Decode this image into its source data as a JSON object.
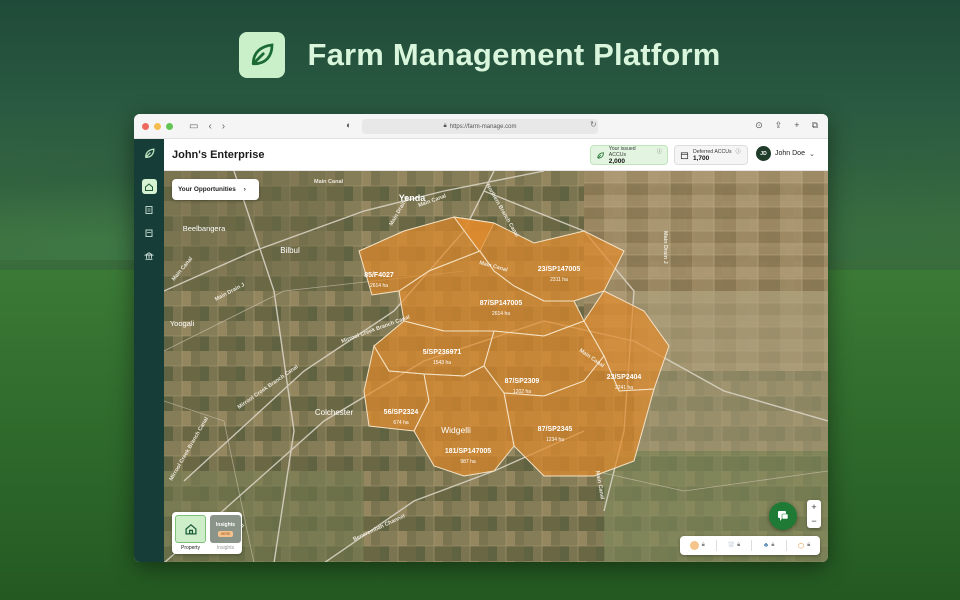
{
  "promo": {
    "title": "Farm Management Platform"
  },
  "browser": {
    "url": "https://farm-manage.com",
    "traffic_colors": [
      "#ee6a5f",
      "#f5be4f",
      "#62c554"
    ]
  },
  "app": {
    "enterprise_name": "John's Enterprise",
    "issued": {
      "label": "Your issued ACCUs",
      "value": "2,000"
    },
    "deferred": {
      "label": "Deferred ACCUs",
      "value": "1,700"
    },
    "user": {
      "initials": "JD",
      "name": "John Doe"
    }
  },
  "map": {
    "opportunities_label": "Your Opportunities",
    "towns": [
      "Yenda",
      "Beelbangera",
      "Bilbul",
      "Yoogali",
      "Colchester",
      "Widgelli"
    ],
    "roads": [
      "Main Canal",
      "Northern Branch Canal",
      "Main Drain J",
      "Main Canal",
      "Mirrool Creek Branch Canal",
      "Mirrool Creek Branch Canal",
      "Main Canal",
      "Main Drain J",
      "Main Canal",
      "Main Canal",
      "Mirrool Creek Branch Canal",
      "Main Canal",
      "Benerembah Channel",
      "Main Canal",
      "Main Drain J"
    ],
    "parcels": [
      {
        "lot": "85/F4027",
        "area": "2614 ha"
      },
      {
        "lot": "23/SP147005",
        "area": "2311 ha"
      },
      {
        "lot": "87/SP147005",
        "area": "2614 ha"
      },
      {
        "lot": "5/SP236971",
        "area": "1543 ha"
      },
      {
        "lot": "87/SP2309",
        "area": "1202 ha"
      },
      {
        "lot": "23/SP2404",
        "area": "2241 ha"
      },
      {
        "lot": "56/SP2324",
        "area": "674 ha"
      },
      {
        "lot": "87/SP2345",
        "area": "1234 ha"
      },
      {
        "lot": "181/SP147005",
        "area": "987 ha"
      }
    ],
    "overlay_color": "#e08a2c"
  },
  "layers": {
    "property_label": "Property",
    "insights_label": "Insights",
    "insights_thumb": "Insights",
    "insights_badge": "HERE"
  },
  "controls": {
    "zoom_in": "+",
    "zoom_out": "−"
  }
}
